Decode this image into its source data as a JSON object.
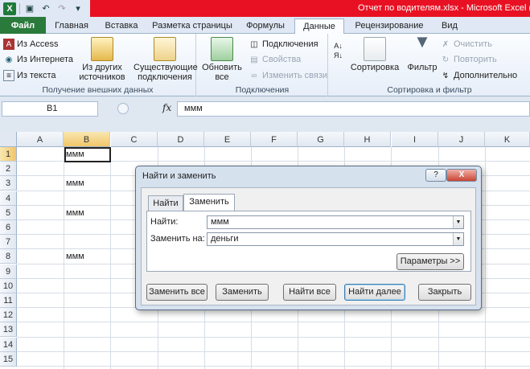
{
  "window": {
    "title": "Отчет по водителям.xlsx  -  Microsoft Excel ("
  },
  "qat": {
    "save_icon": "floppy-disk-icon",
    "undo_icon": "undo-icon",
    "redo_icon": "redo-icon"
  },
  "tabs": [
    {
      "label": "Файл"
    },
    {
      "label": "Главная"
    },
    {
      "label": "Вставка"
    },
    {
      "label": "Разметка страницы"
    },
    {
      "label": "Формулы"
    },
    {
      "label": "Данные"
    },
    {
      "label": "Рецензирование"
    },
    {
      "label": "Вид"
    }
  ],
  "ribbon": {
    "external": {
      "label": "Получение внешних данных",
      "access": "Из Access",
      "web": "Из Интернета",
      "text": "Из текста",
      "other_line1": "Из других",
      "other_line2": "источников",
      "existing_line1": "Существующие",
      "existing_line2": "подключения"
    },
    "connections": {
      "label": "Подключения",
      "refresh_line1": "Обновить",
      "refresh_line2": "все",
      "connections": "Подключения",
      "properties": "Свойства",
      "edit_links": "Изменить связи"
    },
    "sort": {
      "label": "Сортировка и фильтр",
      "sort": "Сортировка",
      "filter": "Фильтр",
      "clear": "Очистить",
      "reapply": "Повторить",
      "advanced": "Дополнительно"
    }
  },
  "formula_bar": {
    "name_box": "B1",
    "fx": "fx",
    "value": "ммм"
  },
  "grid": {
    "columns": [
      "A",
      "B",
      "C",
      "D",
      "E",
      "F",
      "G",
      "H",
      "I",
      "J",
      "K"
    ],
    "rows": [
      "1",
      "2",
      "3",
      "4",
      "5",
      "6",
      "7",
      "8",
      "9",
      "10",
      "11",
      "12",
      "13",
      "14",
      "15"
    ],
    "cells": {
      "B1": "ммм",
      "B3": "ммм",
      "B5": "ммм",
      "B8": "ммм"
    },
    "selected": "B1"
  },
  "dialog": {
    "title": "Найти и заменить",
    "help": "?",
    "close": "X",
    "tab_find": "Найти",
    "tab_replace": "Заменить",
    "find_label": "Найти:",
    "find_value": "ммм",
    "replace_label": "Заменить на:",
    "replace_value": "деньги",
    "options_button": "Параметры >>",
    "buttons": {
      "replace_all": "Заменить все",
      "replace": "Заменить",
      "find_all": "Найти все",
      "find_next": "Найти далее",
      "close": "Закрыть"
    }
  }
}
